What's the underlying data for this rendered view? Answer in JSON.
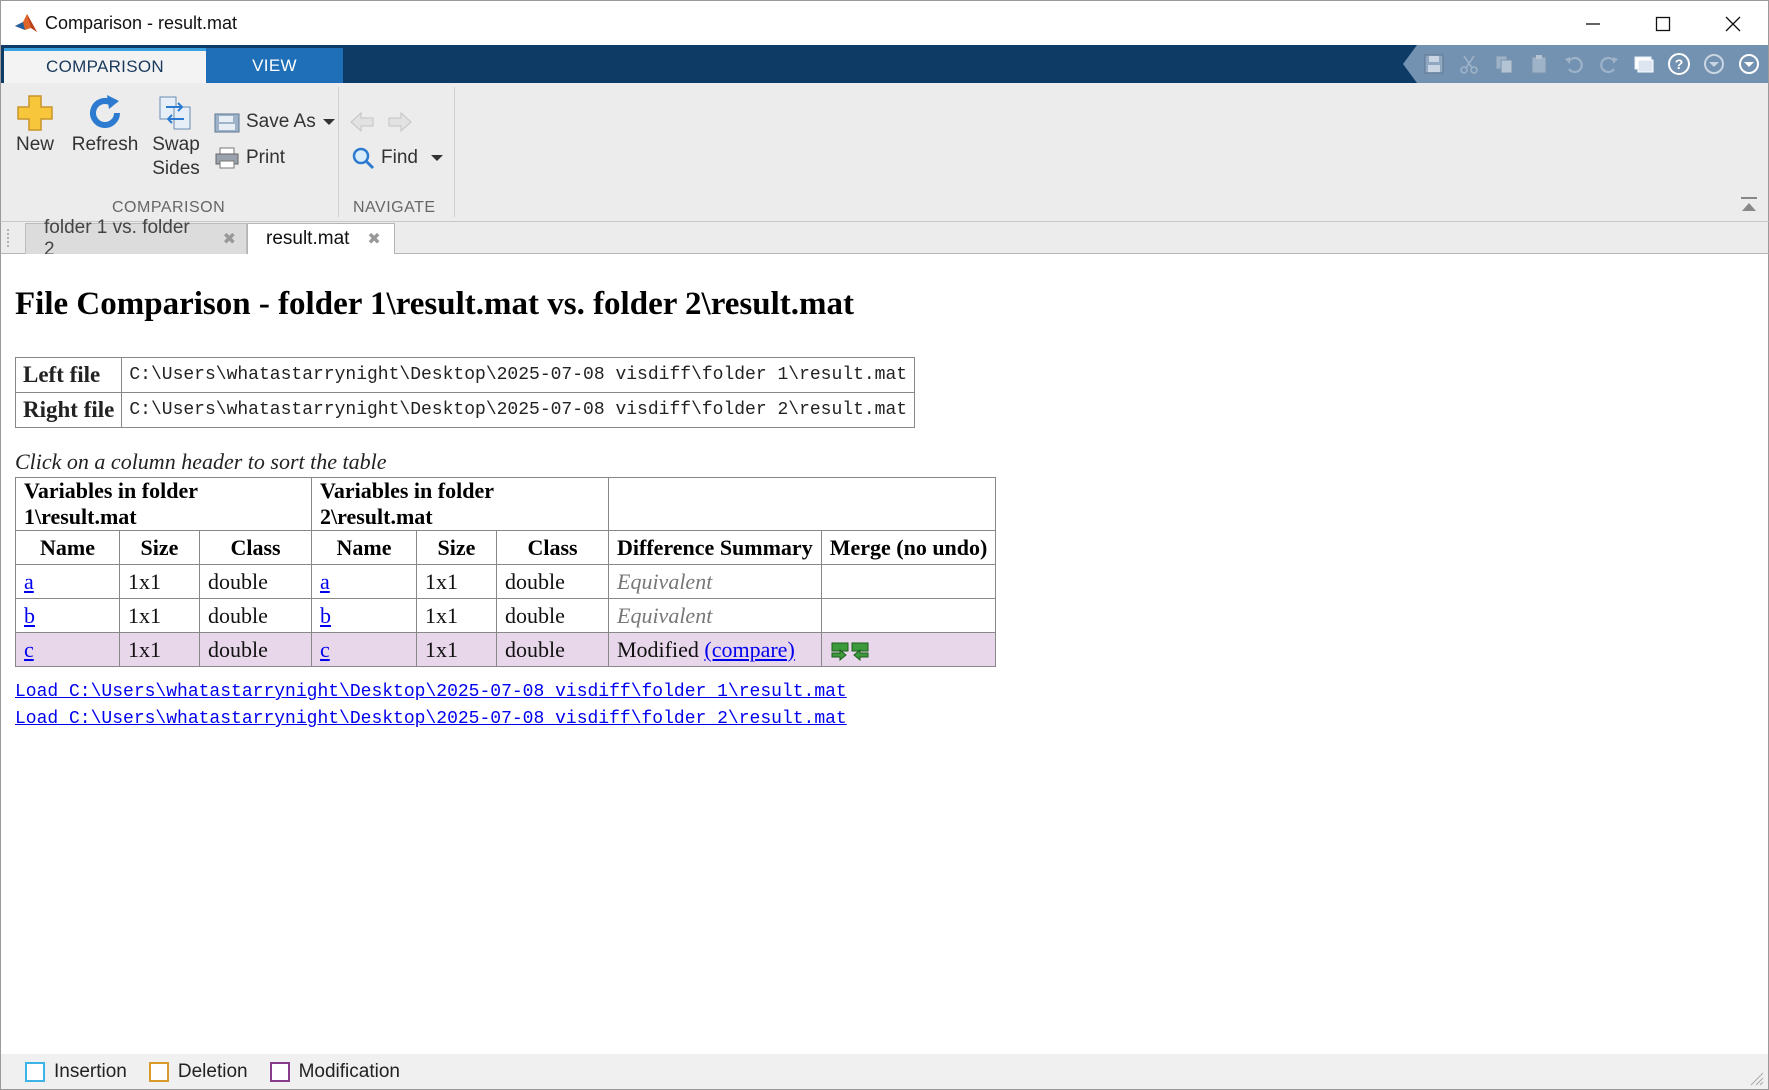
{
  "window": {
    "title": "Comparison - result.mat",
    "controls": {
      "minimize_icon": "minimize-icon",
      "maximize_icon": "maximize-icon",
      "close_icon": "close-icon"
    }
  },
  "ribbon": {
    "tabs": [
      {
        "label": "COMPARISON",
        "active": true
      },
      {
        "label": "VIEW",
        "active": false
      }
    ],
    "sections": {
      "comparison": {
        "label": "COMPARISON",
        "new_label": "New",
        "refresh_label": "Refresh",
        "swap_label_1": "Swap",
        "swap_label_2": "Sides",
        "save_as_label": "Save As",
        "print_label": "Print"
      },
      "navigate": {
        "label": "NAVIGATE",
        "find_label": "Find"
      }
    },
    "quick_access": [
      "save-icon",
      "cut-icon",
      "copy-icon",
      "paste-icon",
      "undo-icon",
      "redo-icon",
      "switch-windows-icon",
      "help-icon",
      "minimize-toolstrip-icon",
      "dropdown-icon"
    ]
  },
  "doc_tabs": [
    {
      "label": "folder 1 vs. folder 2",
      "active": false
    },
    {
      "label": "result.mat",
      "active": true
    }
  ],
  "report": {
    "title": "File Comparison - folder 1\\result.mat vs. folder 2\\result.mat",
    "left_file_label": "Left file",
    "left_file_path": "C:\\Users\\whatastarrynight\\Desktop\\2025-07-08 visdiff\\folder 1\\result.mat",
    "right_file_label": "Right file",
    "right_file_path": "C:\\Users\\whatastarrynight\\Desktop\\2025-07-08 visdiff\\folder 2\\result.mat",
    "hint": "Click on a column header to sort the table",
    "group_left": "Variables in folder 1\\result.mat",
    "group_right": "Variables in folder 2\\result.mat",
    "headers": [
      "Name",
      "Size",
      "Class",
      "Name",
      "Size",
      "Class",
      "Difference Summary",
      "Merge (no undo)"
    ],
    "rows": [
      {
        "l_name": "a",
        "l_size": "1x1",
        "l_class": "double",
        "r_name": "a",
        "r_size": "1x1",
        "r_class": "double",
        "summary": "Equivalent"
      },
      {
        "l_name": "b",
        "l_size": "1x1",
        "l_class": "double",
        "r_name": "b",
        "r_size": "1x1",
        "r_class": "double",
        "summary": "Equivalent"
      },
      {
        "l_name": "c",
        "l_size": "1x1",
        "l_class": "double",
        "r_name": "c",
        "r_size": "1x1",
        "r_class": "double",
        "summary": "Modified",
        "compare_link": "(compare)"
      }
    ],
    "load_left": "Load C:\\Users\\whatastarrynight\\Desktop\\2025-07-08 visdiff\\folder 1\\result.mat",
    "load_right": "Load C:\\Users\\whatastarrynight\\Desktop\\2025-07-08 visdiff\\folder 2\\result.mat"
  },
  "legend": {
    "insertion": {
      "label": "Insertion",
      "color": "#3db3e8"
    },
    "deletion": {
      "label": "Deletion",
      "color": "#d99a2b"
    },
    "modification": {
      "label": "Modification",
      "color": "#8a3a8c"
    }
  },
  "colors": {
    "ribbon_bar": "#0d3b66",
    "view_tab": "#1f6fb8",
    "modified_row": "#e8d6ea",
    "link": "#0000ee"
  }
}
